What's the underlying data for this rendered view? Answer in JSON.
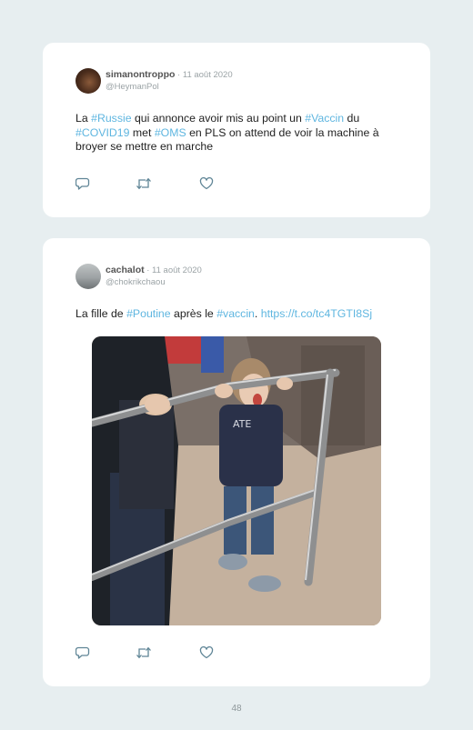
{
  "tweets": [
    {
      "author": "simanontroppo",
      "date": " · 11 août 2020",
      "handle": "@HeymanPol",
      "text_parts": [
        {
          "t": "La ",
          "tag": false
        },
        {
          "t": "#Russie",
          "tag": true
        },
        {
          "t": " qui annonce avoir mis au point un ",
          "tag": false
        },
        {
          "t": "#Vaccin",
          "tag": true
        },
        {
          "t": " du ",
          "tag": false
        },
        {
          "t": "#COVID19",
          "tag": true
        },
        {
          "t": " met ",
          "tag": false
        },
        {
          "t": "#OMS",
          "tag": true
        },
        {
          "t": " en PLS on attend de voir la machine à broyer se mettre en marche",
          "tag": false
        }
      ]
    },
    {
      "author": "cachalot",
      "date": " · 11 août 2020",
      "handle": "@chokrikchaou",
      "text_parts": [
        {
          "t": "La fille de ",
          "tag": false
        },
        {
          "t": "#Poutine",
          "tag": true
        },
        {
          "t": " après le ",
          "tag": false
        },
        {
          "t": "#vaccin",
          "tag": true
        },
        {
          "t": ". ",
          "tag": false
        },
        {
          "t": "https://t.co/tc4TGTI8Sj",
          "tag": true
        }
      ],
      "media_description": "video-still"
    }
  ],
  "icons": {
    "reply": "reply-icon",
    "retweet": "retweet-icon",
    "like": "heart-icon"
  },
  "colors": {
    "accent": "#5fb6e0",
    "background": "#e7eef0",
    "icon": "#5f8596"
  },
  "page_number": "48"
}
